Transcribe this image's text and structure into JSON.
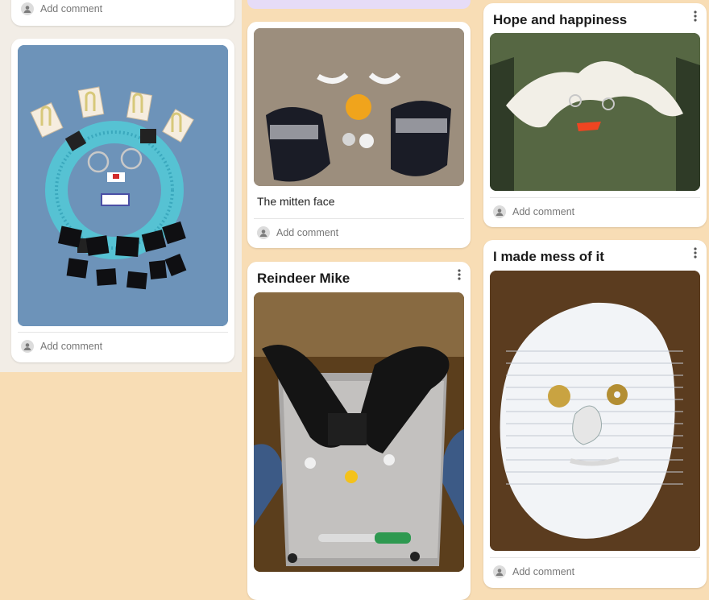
{
  "board": {
    "comment_placeholder": "Add comment",
    "cards": [
      {
        "id": "top-left-stub"
      },
      {
        "id": "beaded-face"
      },
      {
        "id": "mitten-face",
        "caption": "The mitten face"
      },
      {
        "id": "reindeer",
        "title": "Reindeer Mike"
      },
      {
        "id": "hope",
        "title": "Hope and happiness"
      },
      {
        "id": "mess",
        "title": "I made mess of it"
      }
    ]
  },
  "colors": {
    "background": "#f8ddb5",
    "card": "#ffffff",
    "lavender_strip": "#e6dcf7"
  }
}
